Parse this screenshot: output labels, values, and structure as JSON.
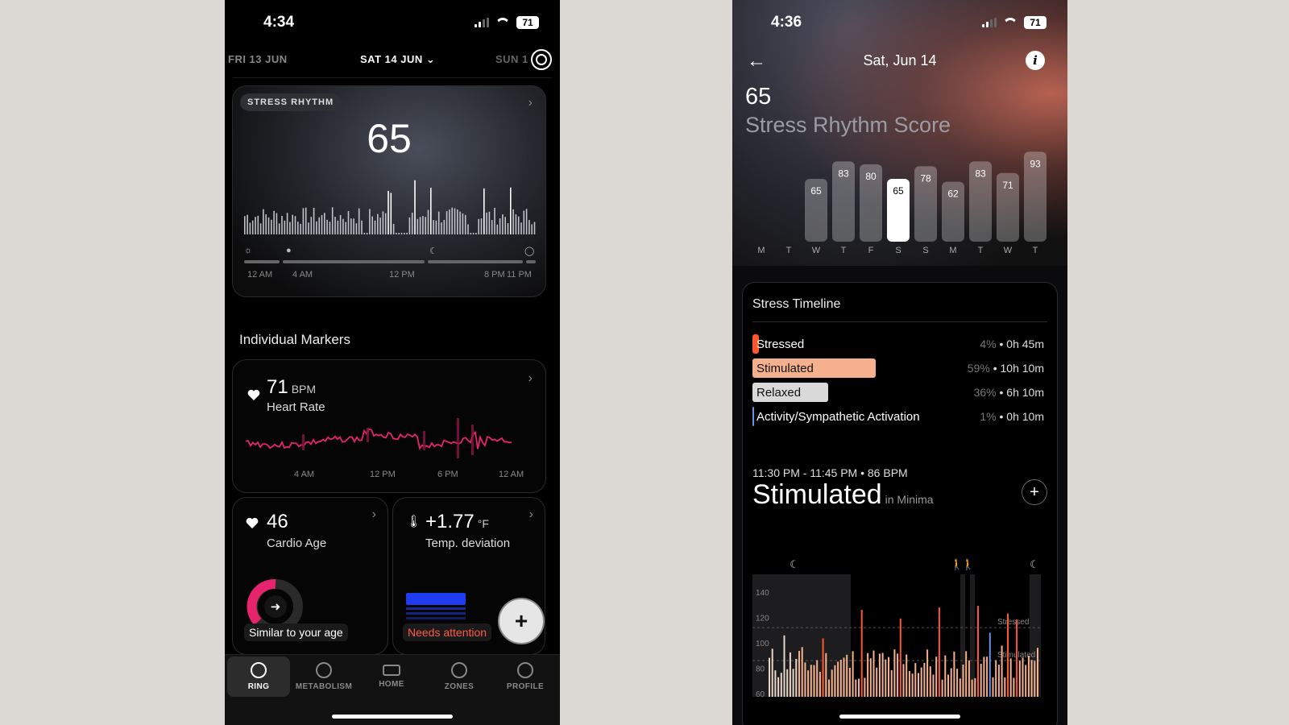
{
  "left_phone": {
    "status": {
      "time": "4:34",
      "battery": "71"
    },
    "date_nav": {
      "prev": "FRI 13 JUN",
      "current": "SAT 14 JUN",
      "next": "SUN 1"
    },
    "stress_card": {
      "pill": "STRESS RHYTHM",
      "score": "65",
      "time_labels": [
        "12 AM",
        "4 AM",
        "12 PM",
        "8 PM",
        "11 PM"
      ]
    },
    "section_title": "Individual Markers",
    "heart_rate": {
      "value": "71",
      "unit": "BPM",
      "label": "Heart Rate",
      "x_labels": [
        "4 AM",
        "12 PM",
        "6 PM",
        "12 AM"
      ],
      "accent": "#e6246e"
    },
    "cardio_age": {
      "value": "46",
      "label": "Cardio Age",
      "tag": "Similar to your age",
      "accent": "#e6246e"
    },
    "temperature": {
      "value": "+1.77",
      "unit": "°F",
      "label": "Temp. deviation",
      "tag": "Needs attention",
      "tag_color": "#ff5a4a",
      "bar_color": "#1f3cf0"
    },
    "fab": "+",
    "tabs": [
      {
        "label": "RING",
        "icon": "ring-icon",
        "active": true
      },
      {
        "label": "METABOLISM",
        "icon": "metabolism-icon",
        "active": false
      },
      {
        "label": "HOME",
        "icon": "home-icon",
        "active": false
      },
      {
        "label": "ZONES",
        "icon": "zones-icon",
        "active": false
      },
      {
        "label": "PROFILE",
        "icon": "profile-icon",
        "active": false
      }
    ]
  },
  "right_phone": {
    "status": {
      "time": "4:36",
      "battery": "71"
    },
    "header": {
      "date": "Sat, Jun 14",
      "info": "i"
    },
    "score": "65",
    "score_label": "Stress Rhythm Score",
    "weekly_chart": {
      "days": [
        "M",
        "T",
        "W",
        "T",
        "F",
        "S",
        "S",
        "M",
        "T",
        "W",
        "T"
      ],
      "scores": [
        null,
        null,
        65,
        83,
        80,
        65,
        78,
        62,
        83,
        71,
        93
      ],
      "selected_index": 5
    },
    "timeline": {
      "title": "Stress Timeline",
      "categories": [
        {
          "name": "Stressed",
          "percent": "4%",
          "duration": "0h 45m",
          "fraction": 0.04,
          "color": "#ff5630"
        },
        {
          "name": "Stimulated",
          "percent": "59%",
          "duration": "10h 10m",
          "fraction": 0.59,
          "color": "#f5b08e"
        },
        {
          "name": "Relaxed",
          "percent": "36%",
          "duration": "6h 10m",
          "fraction": 0.36,
          "color": "#d9d9d9"
        },
        {
          "name": "Activity/Sympathetic Activation",
          "percent": "1%",
          "duration": "0h 10m",
          "fraction": 0.01,
          "color": "#6f8fe0"
        }
      ],
      "segment_meta": "11:30 PM - 11:45 PM • 86 BPM",
      "segment_state": "Stimulated",
      "segment_sub": "in Minima",
      "add": "+",
      "chart": {
        "y_ticks": [
          "140",
          "120",
          "100",
          "80",
          "60"
        ],
        "threshold_labels": [
          "Stressed",
          "Stimulated"
        ]
      }
    }
  }
}
